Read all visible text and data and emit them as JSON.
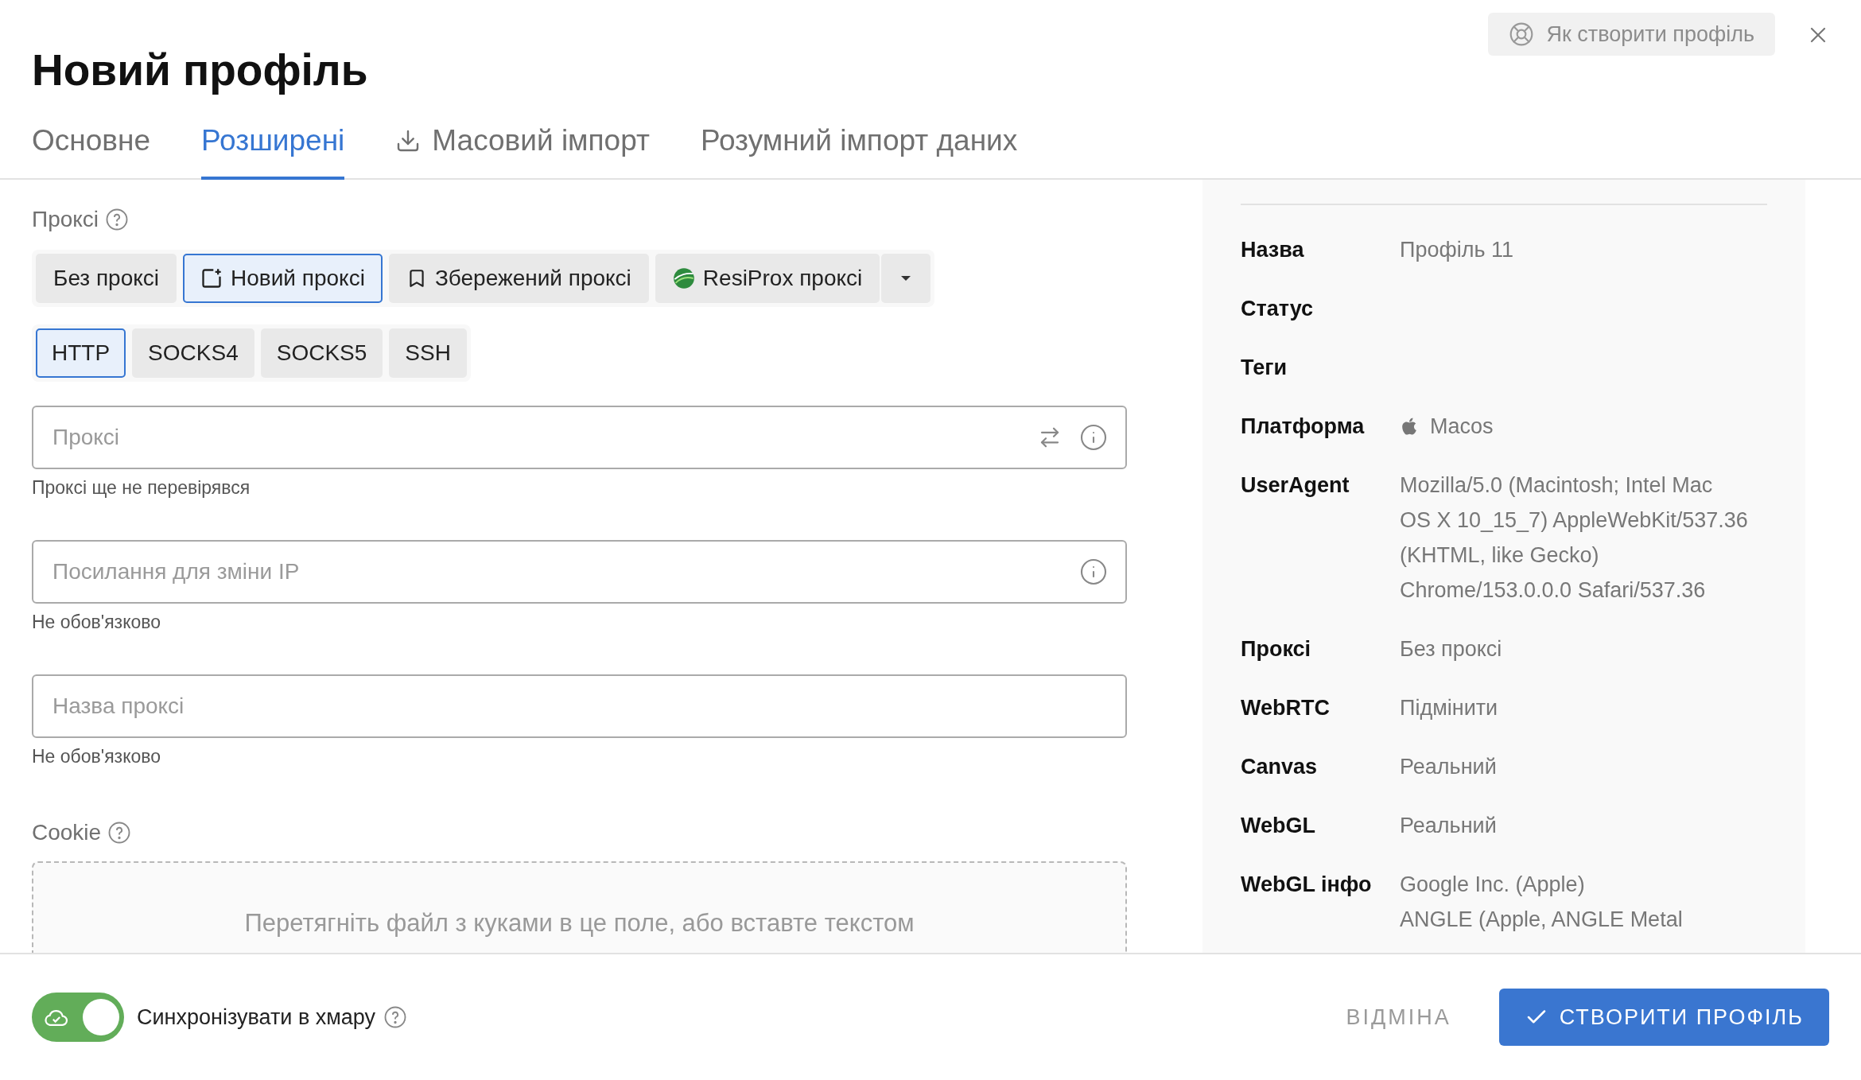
{
  "dialog": {
    "title": "Новий профіль",
    "help_button": "Як створити профіль"
  },
  "tabs": [
    {
      "label": "Основне",
      "selected": false,
      "kind": "plain"
    },
    {
      "label": "Розширені",
      "selected": true,
      "kind": "plain"
    },
    {
      "label": "Масовий імпорт",
      "selected": false,
      "kind": "download"
    },
    {
      "label": "Розумний імпорт даних",
      "selected": false,
      "kind": "plain"
    }
  ],
  "proxy": {
    "label": "Проксі",
    "sources": [
      {
        "label": "Без проксі",
        "selected": false,
        "kind": "plain"
      },
      {
        "label": "Новий проксі",
        "selected": true,
        "kind": "new"
      },
      {
        "label": "Збережений проксі",
        "selected": false,
        "kind": "saved"
      },
      {
        "label": "ResiProx проксі",
        "selected": false,
        "kind": "provider"
      }
    ],
    "protocols": [
      {
        "label": "HTTP",
        "selected": true
      },
      {
        "label": "SOCKS4",
        "selected": false
      },
      {
        "label": "SOCKS5",
        "selected": false
      },
      {
        "label": "SSH",
        "selected": false
      }
    ],
    "fields": [
      {
        "placeholder": "Проксі",
        "helper": "Проксі ще не перевірявся",
        "kind": "proxy"
      },
      {
        "placeholder": "Посилання для зміни IP",
        "helper": "Не обов'язково",
        "kind": "link"
      },
      {
        "placeholder": "Назва проксі",
        "helper": "Не обов'язково",
        "kind": "plain"
      }
    ]
  },
  "cookie": {
    "label": "Cookie",
    "dropzone": "Перетягніть файл з куками в це поле, або вставте текстом"
  },
  "summary": [
    {
      "label": "Назва",
      "lines": [
        "Профіль 11"
      ],
      "kind": "text"
    },
    {
      "label": "Статус"
    },
    {
      "label": "Теги"
    },
    {
      "label": "Платформа",
      "lines": [
        "Macos"
      ],
      "kind": "platform"
    },
    {
      "label": "UserAgent",
      "lines": [
        "Mozilla/5.0 (Macintosh; Intel Mac",
        "OS X 10_15_7) AppleWebKit/537.36",
        "(KHTML, like Gecko)",
        "Chrome/153.0.0.0 Safari/537.36"
      ],
      "kind": "text"
    },
    {
      "label": "Проксі",
      "lines": [
        "Без проксі"
      ],
      "kind": "text"
    },
    {
      "label": "WebRTC",
      "lines": [
        "Підмінити"
      ],
      "kind": "text"
    },
    {
      "label": "Canvas",
      "lines": [
        "Реальний"
      ],
      "kind": "text"
    },
    {
      "label": "WebGL",
      "lines": [
        "Реальний"
      ],
      "kind": "text"
    },
    {
      "label": "WebGL інфо",
      "lines": [
        "Google Inc. (Apple)",
        "ANGLE (Apple, ANGLE Metal"
      ],
      "kind": "text"
    }
  ],
  "footer": {
    "sync": {
      "label": "Синхронізувати в хмару",
      "on": true
    },
    "cancel": "ВІДМІНА",
    "create": "СТВОРИТИ ПРОФІЛЬ"
  }
}
